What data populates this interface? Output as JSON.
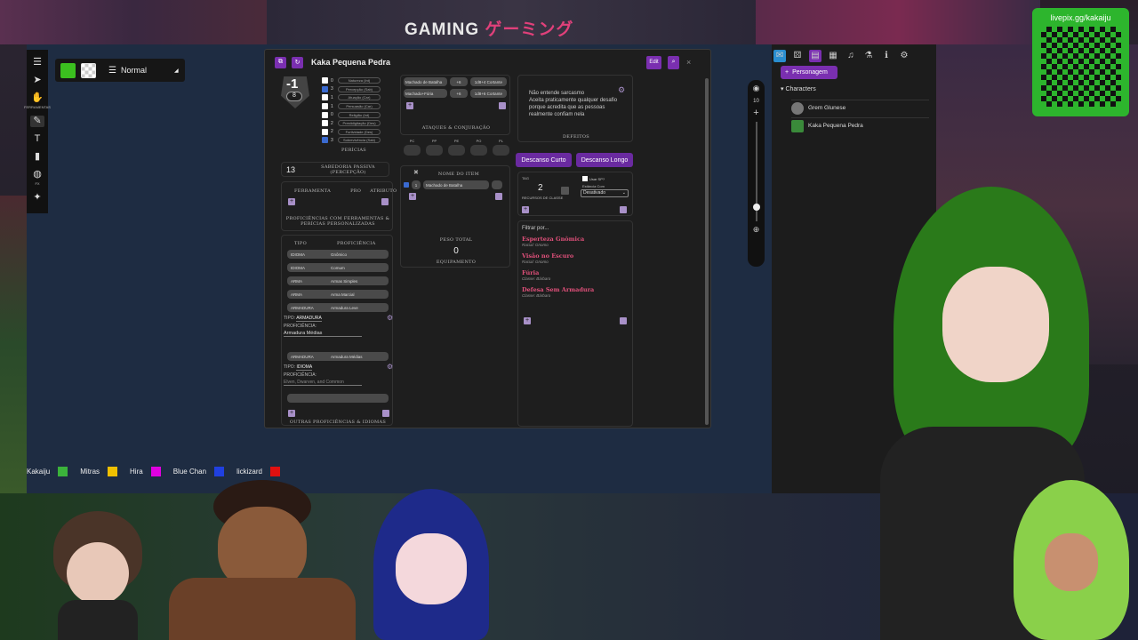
{
  "stream": {
    "banner_text": "GAMING",
    "banner_jp": "ゲーミング",
    "qr_url": "livepix.gg/kakaiju",
    "participants": [
      {
        "name": "Kakaiju",
        "color": "#3bb33b"
      },
      {
        "name": "Mitras",
        "color": "#f0c000"
      },
      {
        "name": "Hira",
        "color": "#e000e0"
      },
      {
        "name": "Blue Chan",
        "color": "#2040e0"
      },
      {
        "name": "lickizard",
        "color": "#e01010"
      }
    ]
  },
  "toolbar": {
    "tools_label": "FERRAMENTAS",
    "fx_label": "FX",
    "layer_label": "Normal",
    "colors": {
      "primary": "#3bbf1f",
      "secondary": "transparent"
    }
  },
  "sheet": {
    "title": "Kaka Pequena Pedra",
    "edit_label": "Edit",
    "modifier": "-1",
    "score": "8",
    "skills": [
      {
        "value": "0",
        "name": "Natureza (Int)",
        "checked": false
      },
      {
        "value": "3",
        "name": "Percepção (Sab)",
        "checked": true
      },
      {
        "value": "1",
        "name": "Atuação (Car)",
        "checked": false
      },
      {
        "value": "1",
        "name": "Persuasão (Car)",
        "checked": false
      },
      {
        "value": "0",
        "name": "Religião (Int)",
        "checked": false
      },
      {
        "value": "2",
        "name": "Prestidigitação (Des)",
        "checked": false
      },
      {
        "value": "2",
        "name": "Furtividade (Des)",
        "checked": false
      },
      {
        "value": "3",
        "name": "Sobrevivência (Sab)",
        "checked": true
      }
    ],
    "skills_label": "PERÍCIAS",
    "passive_value": "13",
    "passive_label": "SABEDORIA PASSIVA (PERCEPÇÃO)",
    "tool_cols": [
      "FERRAMENTA",
      "PRO",
      "ATRIBUTO"
    ],
    "tool_prof_label": "PROFICIÊNCIAS COM FERRAMENTAS & PERÍCIAS PERSONALIZADAS",
    "prof_cols": [
      "TIPO",
      "PROFICIÊNCIA"
    ],
    "proficiencies": [
      {
        "type": "IDIOMA",
        "name": "Gnômico"
      },
      {
        "type": "IDIOMA",
        "name": "Comum"
      },
      {
        "type": "ARMA",
        "name": "Armas Simples"
      },
      {
        "type": "ARMA",
        "name": "Arma Marcial"
      },
      {
        "type": "ARMADURA",
        "name": "Armadura Leve"
      }
    ],
    "edit_rows": [
      {
        "type_label": "TIPO:",
        "type_value": "ARMADURA",
        "prof_label": "PROFICIÊNCIA:",
        "prof_value": "Armadura Médias"
      },
      {
        "type_label": "TIPO:",
        "type_value": "IDIOMA",
        "prof_label": "PROFICIÊNCIA:",
        "prof_value": "Elven, Dwarven, and Common"
      }
    ],
    "row_armor_type": "ARMADURA",
    "row_armor_name": "Armadura Médias",
    "other_prof_label": "OUTRAS PROFICIÊNCIAS & IDIOMAS",
    "attacks": [
      {
        "name": "Machado de Batalha",
        "bonus": "+6",
        "damage": "1d8+4 Cortante"
      },
      {
        "name": "Machado+Fúria",
        "bonus": "+6",
        "damage": "1d8+6 Cortante"
      }
    ],
    "attacks_label": "ATAQUES & CONJURAÇÃO",
    "coins": [
      "PC",
      "PP",
      "PE",
      "PO",
      "PL"
    ],
    "inventory_header": "NOME DO ITEM",
    "inventory": [
      {
        "qty": "1",
        "name": "Machado de Batalha"
      }
    ],
    "weight_label": "PESO TOTAL",
    "weight_value": "0",
    "equip_label": "EQUIPAMENTO",
    "flaws_text": "Não entende sarcasmo\nAceita praticamente qualquer desafio porque acredita que as pessoas realmente confiam nela",
    "flaws_label": "DEFEITOS",
    "short_rest": "Descanso Curto",
    "long_rest": "Descanso Longo",
    "class_res_tag": "TAG",
    "class_res_value": "2",
    "class_res_label": "RECURSOS DE CLASSE",
    "use_sp_label": "Usar SP?",
    "restore_label": "Estância Com",
    "restore_value": "Desativado",
    "filter_label": "Filtrar por...",
    "features": [
      {
        "name": "Esperteza Gnômica",
        "source": "Racial: Gnomo"
      },
      {
        "name": "Visão no Escuro",
        "source": "Racial: Gnomo"
      },
      {
        "name": "Fúria",
        "source": "Classe: Bárbaro"
      },
      {
        "name": "Defesa Sem Armadura",
        "source": "Classe: Bárbaro"
      }
    ]
  },
  "right_panel": {
    "add_label": "Personagem",
    "section_label": "Characters",
    "characters": [
      "Grem Glunese",
      "Kaka Pequena Pedra"
    ]
  },
  "zoom": {
    "level": "10"
  }
}
